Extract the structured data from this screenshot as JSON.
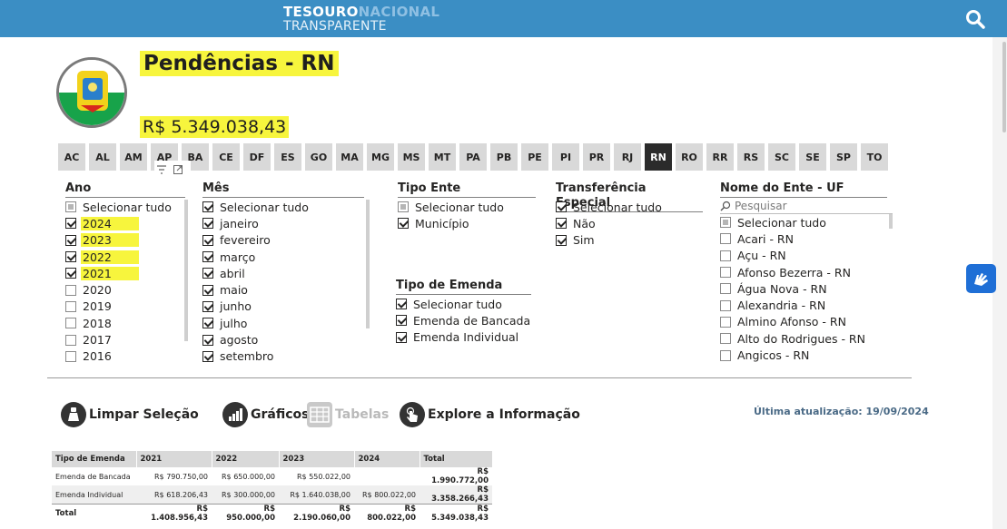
{
  "header": {
    "brand_line1_a": "TESOURO",
    "brand_line1_b": "NACIONAL",
    "brand_line2": "TRANSPARENTE",
    "search_icon": "search-icon"
  },
  "page": {
    "title": "Pendências - RN",
    "total": "R$ 5.349.038,43",
    "highlight_color": "#f7f53d"
  },
  "ufs": [
    {
      "code": "AC",
      "active": false
    },
    {
      "code": "AL",
      "active": false
    },
    {
      "code": "AM",
      "active": false
    },
    {
      "code": "AP",
      "active": false
    },
    {
      "code": "BA",
      "active": false
    },
    {
      "code": "CE",
      "active": false
    },
    {
      "code": "DF",
      "active": false
    },
    {
      "code": "ES",
      "active": false
    },
    {
      "code": "GO",
      "active": false
    },
    {
      "code": "MA",
      "active": false
    },
    {
      "code": "MG",
      "active": false
    },
    {
      "code": "MS",
      "active": false
    },
    {
      "code": "MT",
      "active": false
    },
    {
      "code": "PA",
      "active": false
    },
    {
      "code": "PB",
      "active": false
    },
    {
      "code": "PE",
      "active": false
    },
    {
      "code": "PI",
      "active": false
    },
    {
      "code": "PR",
      "active": false
    },
    {
      "code": "RJ",
      "active": false
    },
    {
      "code": "RN",
      "active": true
    },
    {
      "code": "RO",
      "active": false
    },
    {
      "code": "RR",
      "active": false
    },
    {
      "code": "RS",
      "active": false
    },
    {
      "code": "SC",
      "active": false
    },
    {
      "code": "SE",
      "active": false
    },
    {
      "code": "SP",
      "active": false
    },
    {
      "code": "TO",
      "active": false
    }
  ],
  "slicers": {
    "ano": {
      "title": "Ano",
      "items": [
        {
          "label": "Selecionar tudo",
          "state": "partial",
          "highlight": false
        },
        {
          "label": "2024",
          "state": "checked",
          "highlight": true
        },
        {
          "label": "2023",
          "state": "checked",
          "highlight": true
        },
        {
          "label": "2022",
          "state": "checked",
          "highlight": true
        },
        {
          "label": "2021",
          "state": "checked",
          "highlight": true
        },
        {
          "label": "2020",
          "state": "empty",
          "highlight": false
        },
        {
          "label": "2019",
          "state": "empty",
          "highlight": false
        },
        {
          "label": "2018",
          "state": "empty",
          "highlight": false
        },
        {
          "label": "2017",
          "state": "empty",
          "highlight": false
        },
        {
          "label": "2016",
          "state": "empty",
          "highlight": false
        }
      ]
    },
    "mes": {
      "title": "Mês",
      "items": [
        {
          "label": "Selecionar tudo",
          "state": "checked"
        },
        {
          "label": "janeiro",
          "state": "checked"
        },
        {
          "label": "fevereiro",
          "state": "checked"
        },
        {
          "label": "março",
          "state": "checked"
        },
        {
          "label": "abril",
          "state": "checked"
        },
        {
          "label": "maio",
          "state": "checked"
        },
        {
          "label": "junho",
          "state": "checked"
        },
        {
          "label": "julho",
          "state": "checked"
        },
        {
          "label": "agosto",
          "state": "checked"
        },
        {
          "label": "setembro",
          "state": "checked"
        }
      ]
    },
    "tipo_ente": {
      "title": "Tipo Ente",
      "items": [
        {
          "label": "Selecionar tudo",
          "state": "partial"
        },
        {
          "label": "Município",
          "state": "checked"
        }
      ]
    },
    "transferencia": {
      "title": "Transferência Especial",
      "items": [
        {
          "label": "Selecionar tudo",
          "state": "checked"
        },
        {
          "label": "Não",
          "state": "checked"
        },
        {
          "label": "Sim",
          "state": "checked"
        }
      ]
    },
    "tipo_emenda": {
      "title": "Tipo de Emenda",
      "items": [
        {
          "label": "Selecionar tudo",
          "state": "checked"
        },
        {
          "label": "Emenda de Bancada",
          "state": "checked"
        },
        {
          "label": "Emenda Individual",
          "state": "checked"
        }
      ]
    },
    "nome_ente": {
      "title": "Nome do Ente - UF",
      "search_placeholder": "Pesquisar",
      "items": [
        {
          "label": "Selecionar tudo",
          "state": "partial"
        },
        {
          "label": "Acari - RN",
          "state": "empty"
        },
        {
          "label": "Açu - RN",
          "state": "empty"
        },
        {
          "label": "Afonso Bezerra - RN",
          "state": "empty"
        },
        {
          "label": "Água Nova - RN",
          "state": "empty"
        },
        {
          "label": "Alexandria - RN",
          "state": "empty"
        },
        {
          "label": "Almino Afonso - RN",
          "state": "empty"
        },
        {
          "label": "Alto do Rodrigues - RN",
          "state": "empty"
        },
        {
          "label": "Angicos - RN",
          "state": "empty"
        }
      ]
    }
  },
  "actions": {
    "limpar": "Limpar Seleção",
    "graficos": "Gráficos",
    "tabelas": "Tabelas",
    "explore": "Explore a Informação",
    "updated": "Última atualização: 19/09/2024"
  },
  "table": {
    "headers": [
      "Tipo de Emenda",
      "2021",
      "2022",
      "2023",
      "2024",
      "Total"
    ],
    "rows": [
      [
        "Emenda de Bancada",
        "R$ 790.750,00",
        "R$ 650.000,00",
        "R$ 550.022,00",
        "",
        "R$ 1.990.772,00"
      ],
      [
        "Emenda Individual",
        "R$ 618.206,43",
        "R$ 300.000,00",
        "R$ 1.640.038,00",
        "R$ 800.022,00",
        "R$ 3.358.266,43"
      ]
    ],
    "total": [
      "Total",
      "R$ 1.408.956,43",
      "R$ 950.000,00",
      "R$ 2.190.060,00",
      "R$ 800.022,00",
      "R$ 5.349.038,43"
    ]
  }
}
